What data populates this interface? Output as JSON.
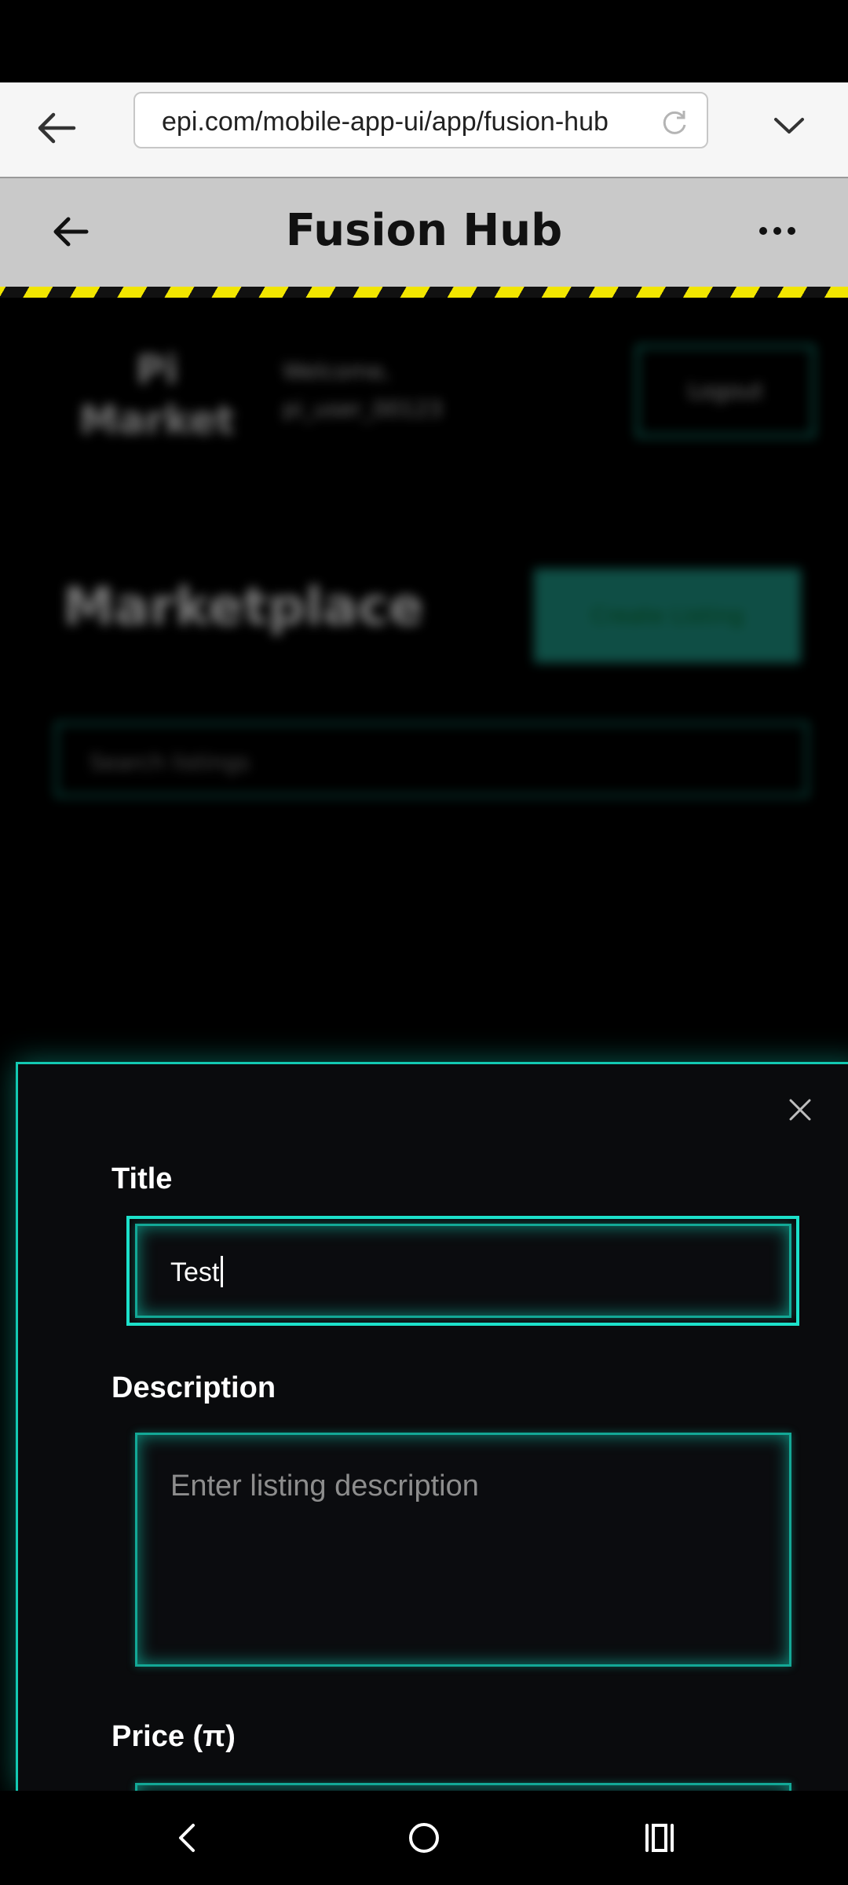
{
  "browser": {
    "url": "epi.com/mobile-app-ui/app/fusion-hub"
  },
  "header": {
    "title": "Fusion Hub"
  },
  "background_page": {
    "logo_line1": "Pi",
    "logo_line2": "Market",
    "user_line1": "Welcome,",
    "user_line2": "pi_user_00123",
    "logout_label": "Logout",
    "heading": "Marketplace",
    "create_button_label": "Create Listing",
    "search_placeholder": "Search listings"
  },
  "modal": {
    "title_label": "Title",
    "title_value": "Test",
    "description_label": "Description",
    "description_placeholder": "Enter listing description",
    "price_label": "Price (π)"
  },
  "colors": {
    "accent": "#13c9b2",
    "header_bg": "#c9c9c9",
    "hazard_yellow": "#f2e600",
    "modal_bg": "#0a0b0d"
  },
  "icons": {
    "browser_back": "arrow-left-icon",
    "reload": "reload-icon",
    "browser_menu": "chevron-down-icon",
    "header_back": "arrow-left-icon",
    "header_more": "more-horizontal-icon",
    "modal_close": "close-icon",
    "nav_back": "nav-back-icon",
    "nav_home": "nav-home-icon",
    "nav_recents": "nav-recents-icon"
  }
}
